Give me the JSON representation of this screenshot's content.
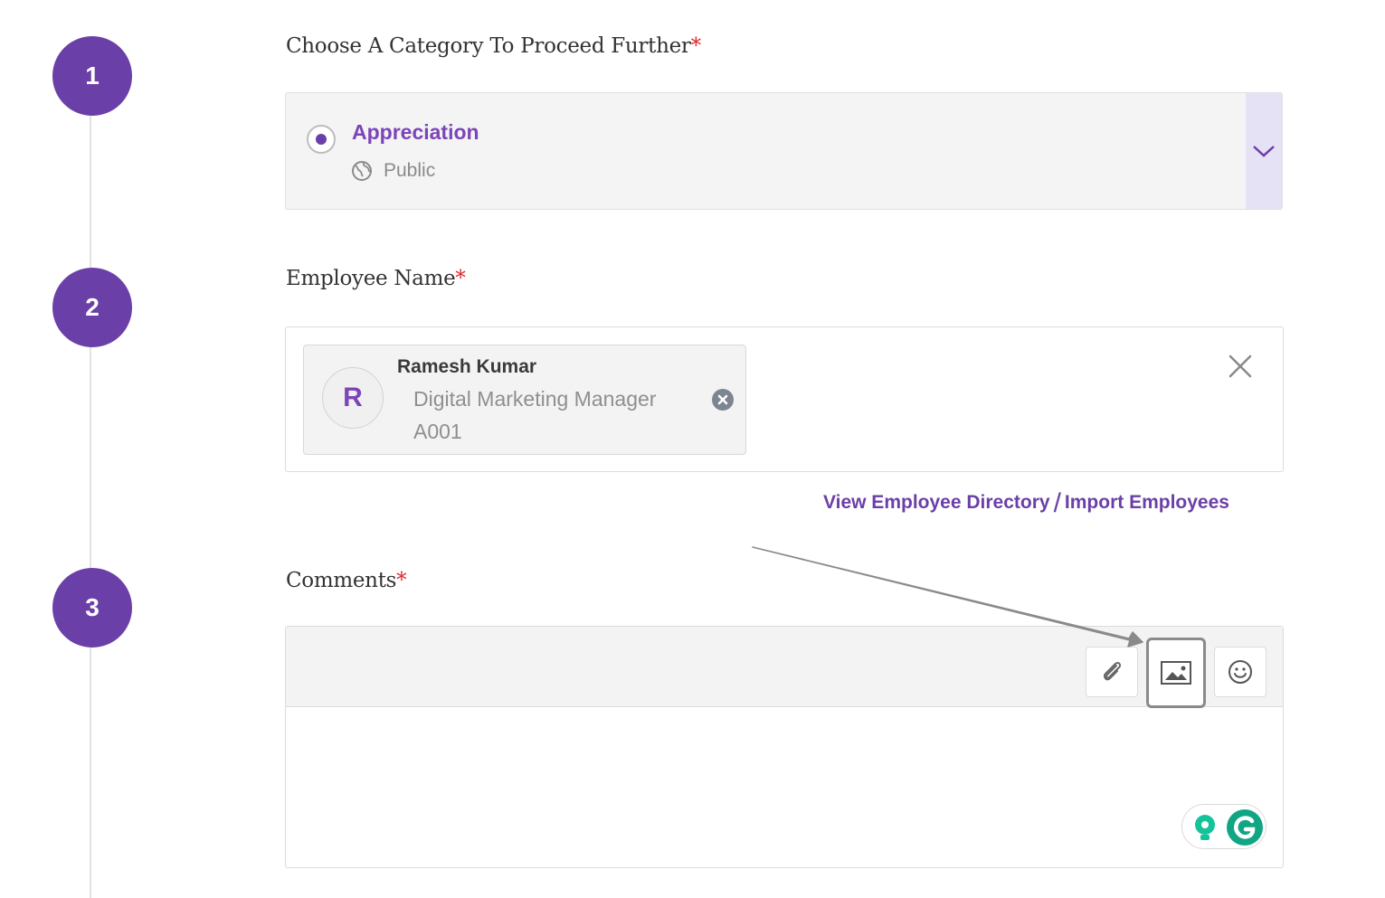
{
  "steps": [
    "1",
    "2",
    "3"
  ],
  "category": {
    "label": "Choose A Category To Proceed Further",
    "required_mark": "*",
    "selected_title": "Appreciation",
    "selected_visibility": "Public"
  },
  "employee": {
    "label": "Employee Name",
    "required_mark": "*",
    "avatar_initial": "R",
    "name": "Ramesh Kumar",
    "role": "Digital Marketing Manager",
    "id": "A001",
    "view_directory_link": "View Employee Directory",
    "separator": "/",
    "import_link": "Import Employees"
  },
  "comments": {
    "label": "Comments",
    "required_mark": "*",
    "value": ""
  },
  "colors": {
    "accent": "#6b3fa8",
    "required": "#e0262c",
    "grammarly_green": "#15c39a"
  },
  "icons": [
    "globe-icon",
    "chevron-down-icon",
    "remove-chip-icon",
    "close-icon",
    "attachment-icon",
    "image-icon",
    "emoji-icon",
    "lightbulb-icon",
    "grammarly-icon"
  ]
}
